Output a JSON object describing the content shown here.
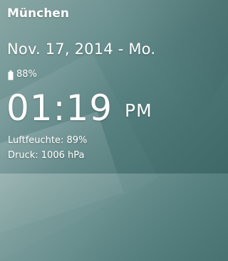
{
  "widget": {
    "city": "München",
    "date": "Nov. 17, 2014 - Mo.",
    "battery": {
      "icon": "battery-icon",
      "percent_label": "88%"
    },
    "time": "01:19",
    "ampm": "PM",
    "humidity": "Luftfeuchte: 89%",
    "pressure": "Druck: 1006 hPa"
  },
  "colors": {
    "text": "#ffffff",
    "background_top": "#8aa8a6",
    "background_bottom": "#3e6868"
  }
}
